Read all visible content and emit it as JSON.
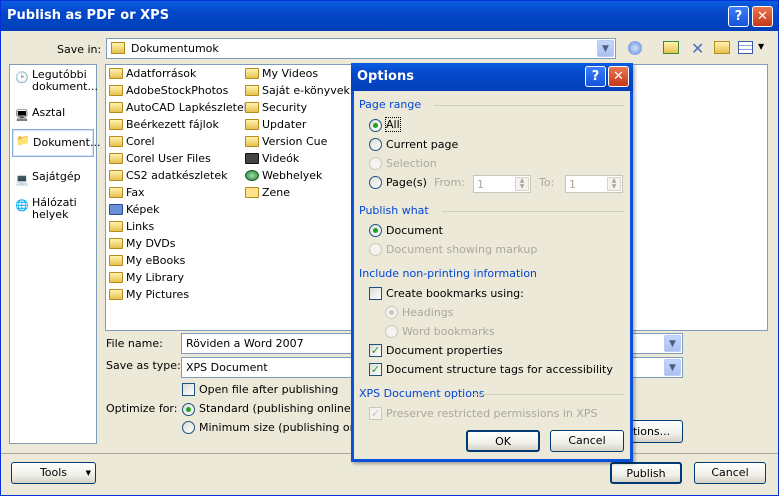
{
  "window": {
    "title": "Publish as PDF or XPS"
  },
  "save_in": {
    "label": "Save in:",
    "value": "Dokumentumok"
  },
  "places": [
    {
      "label": "Legutóbbi dokument...",
      "icon": "recent-documents-icon"
    },
    {
      "label": "Asztal",
      "icon": "desktop-icon"
    },
    {
      "label": "Dokument...",
      "icon": "documents-icon",
      "selected": true
    },
    {
      "label": "Sajátgép",
      "icon": "my-computer-icon"
    },
    {
      "label": "Hálózati helyek",
      "icon": "network-places-icon"
    }
  ],
  "files_col1": [
    "Adatforrások",
    "AdobeStockPhotos",
    "AutoCAD Lapkészletek",
    "Beérkezett fájlok",
    "Corel",
    "Corel User Files",
    "CS2 adatkészletek",
    "Fax",
    "Képek",
    "Links",
    "My DVDs",
    "My eBooks",
    "My Library",
    "My Pictures"
  ],
  "files_col2": [
    "My Videos",
    "Saját e-könyvek",
    "Security",
    "Updater",
    "Version Cue",
    "Videók",
    "Webhelyek",
    "Zene"
  ],
  "file_name": {
    "label": "File name:",
    "value": "Röviden a Word 2007"
  },
  "save_as_type": {
    "label": "Save as type:",
    "value": "XPS Document"
  },
  "open_after": {
    "label": "Open file after publishing"
  },
  "optimize": {
    "label": "Optimize for:",
    "standard": "Standard (publishing online and",
    "minimum": "Minimum size (publishing online)"
  },
  "buttons": {
    "options": "ptions...",
    "tools": "Tools",
    "publish": "Publish",
    "cancel": "Cancel"
  },
  "options": {
    "title": "Options",
    "page_range": "Page range",
    "all": "All",
    "current_page": "Current page",
    "selection": "Selection",
    "pages": "Page(s)",
    "from": "From:",
    "from_value": "1",
    "to": "To:",
    "to_value": "1",
    "publish_what": "Publish what",
    "document": "Document",
    "doc_markup": "Document showing markup",
    "nonprint": "Include non-printing information",
    "create_bookmarks": "Create bookmarks using:",
    "headings": "Headings",
    "word_bookmarks": "Word bookmarks",
    "doc_properties": "Document properties",
    "doc_structure": "Document structure tags for accessibility",
    "xps_options": "XPS Document options",
    "preserve": "Preserve restricted permissions in XPS",
    "ok": "OK",
    "cancel": "Cancel"
  }
}
